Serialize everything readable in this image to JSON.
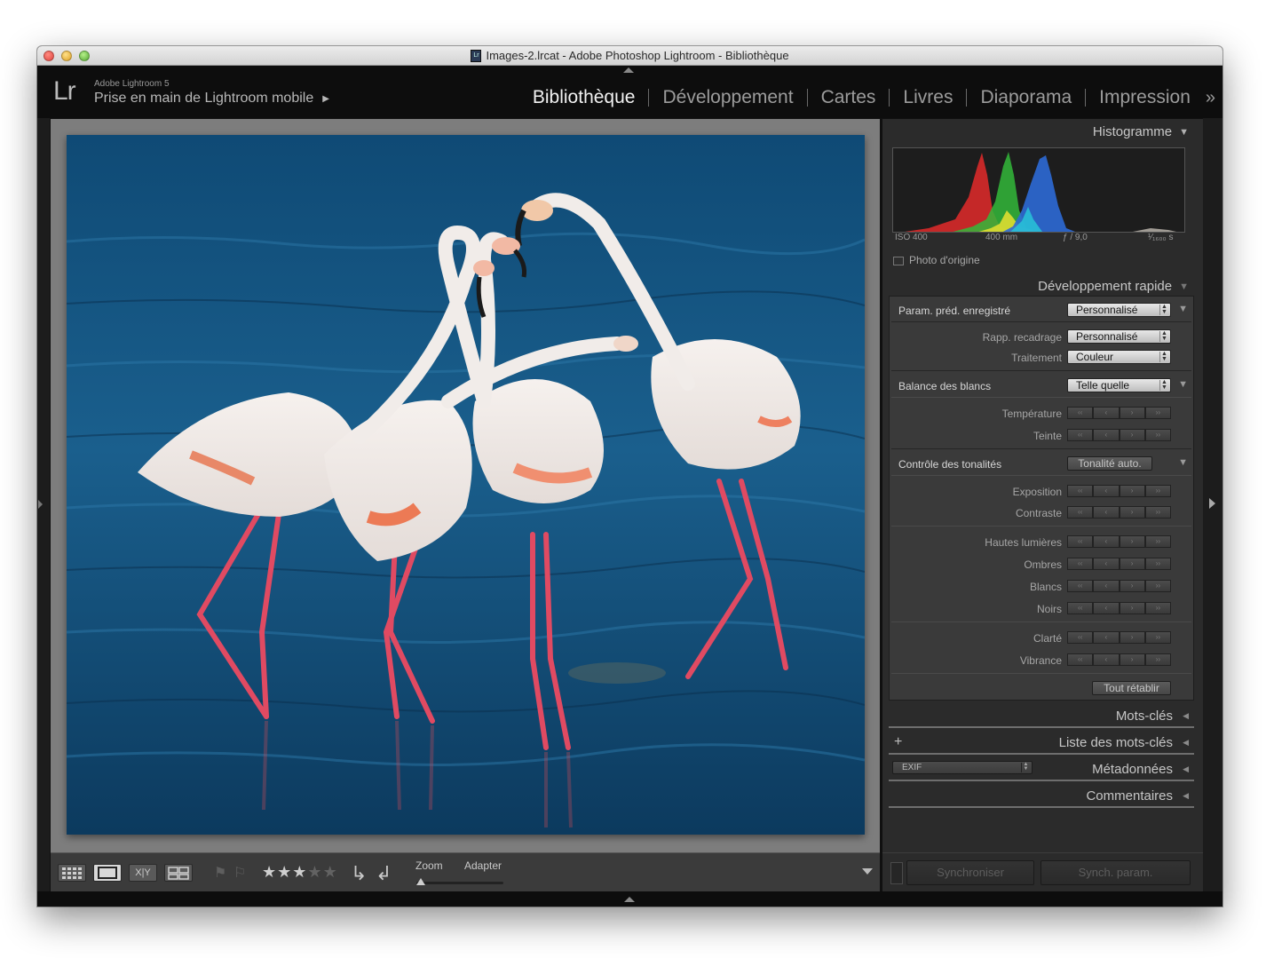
{
  "window": {
    "title": "Images-2.lrcat - Adobe Photoshop Lightroom - Bibliothèque",
    "doc_icon": "Lr"
  },
  "identity": {
    "logo": "Lr",
    "version": "Adobe Lightroom 5",
    "plate": "Prise en main de Lightroom mobile"
  },
  "modules": [
    {
      "label": "Bibliothèque",
      "active": true
    },
    {
      "label": "Développement",
      "active": false
    },
    {
      "label": "Cartes",
      "active": false
    },
    {
      "label": "Livres",
      "active": false
    },
    {
      "label": "Diaporama",
      "active": false
    },
    {
      "label": "Impression",
      "active": false
    }
  ],
  "modules_more": "»",
  "histogram": {
    "title": "Histogramme",
    "iso": "ISO 400",
    "focal": "400 mm",
    "aperture": "ƒ / 9,0",
    "shutter": "¹⁄₁₆₀₀ s",
    "original_photo_label": "Photo d'origine"
  },
  "quick_develop": {
    "title": "Développement rapide",
    "saved_preset": {
      "label": "Param. préd. enregistré",
      "value": "Personnalisé"
    },
    "crop_ratio": {
      "label": "Rapp. recadrage",
      "value": "Personnalisé"
    },
    "treatment": {
      "label": "Traitement",
      "value": "Couleur"
    },
    "white_balance": {
      "label": "Balance des blancs",
      "value": "Telle quelle"
    },
    "temperature": "Température",
    "tint": "Teinte",
    "tone_control": {
      "label": "Contrôle des tonalités",
      "auto_button": "Tonalité auto."
    },
    "exposure": "Exposition",
    "contrast": "Contraste",
    "highlights": "Hautes lumières",
    "shadows": "Ombres",
    "whites": "Blancs",
    "blacks": "Noirs",
    "clarity": "Clarté",
    "vibrance": "Vibrance",
    "reset_all": "Tout rétablir"
  },
  "step_glyphs": {
    "big_down": "‹‹",
    "down": "‹",
    "up": "›",
    "big_up": "››"
  },
  "panels": {
    "keywords": "Mots-clés",
    "keyword_list": "Liste des mots-clés",
    "metadata": "Métadonnées",
    "metadata_preset": "EXIF",
    "comments": "Commentaires"
  },
  "toolbar": {
    "zoom_label": "Zoom",
    "fit_label": "Adapter",
    "compare_label": "X|Y",
    "rating": 3,
    "max_rating": 5
  },
  "sync": {
    "sync_button": "Synchroniser",
    "sync_settings_button": "Synch. param."
  },
  "icons": {
    "grid_view": "grid-view-icon",
    "loupe_view": "loupe-view-icon",
    "compare_view": "compare-view-icon",
    "survey_view": "survey-view-icon",
    "flag": "flag-icon",
    "reject": "reject-flag-icon",
    "rotate_left": "rotate-left-icon",
    "rotate_right": "rotate-right-icon"
  },
  "colors": {
    "background_dark": "#101010",
    "panel": "#2b2b2b",
    "center_background": "#7d7d7d",
    "active_module": "#f2f2f2",
    "inactive_module": "#9c9c9c"
  }
}
